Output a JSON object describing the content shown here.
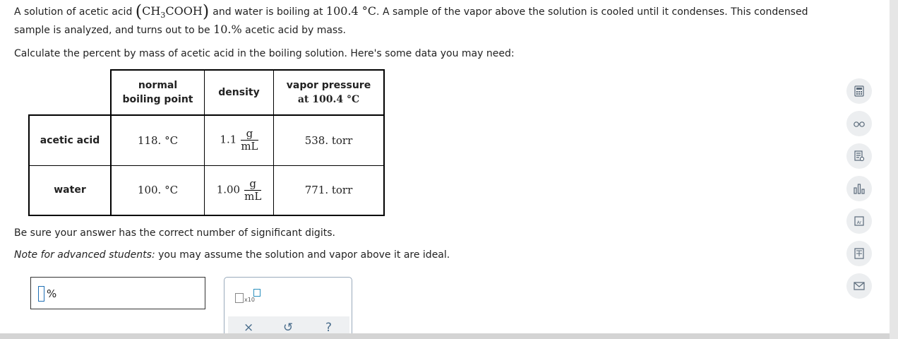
{
  "question": {
    "p1_a": "A solution of acetic acid",
    "formula": {
      "a": "CH",
      "sub": "3",
      "b": "COOH"
    },
    "p1_b": "and water is boiling at",
    "temp": "100.4 °C",
    "p1_c": ". A sample of the vapor above the solution is cooled until it condenses. This condensed",
    "p2_a": "sample is analyzed, and turns out to be",
    "pct": "10.%",
    "p2_b": "acetic acid by mass.",
    "p3": "Calculate the percent by mass of acetic acid in the boiling solution. Here's some data you may need:",
    "sigfigs": "Be sure your answer has the correct number of significant digits.",
    "note_label": "Note for advanced students:",
    "note_text": "you may assume the solution and vapor above it are ideal."
  },
  "table": {
    "headers": {
      "bp_1": "normal",
      "bp_2": "boiling point",
      "density": "density",
      "vp_1": "vapor pressure",
      "vp_2": "at 100.4 °C"
    },
    "rows": [
      {
        "label": "acetic acid",
        "bp": "118. °C",
        "density": "1.1",
        "unit_num": "g",
        "unit_den": "mL",
        "vp": "538. torr"
      },
      {
        "label": "water",
        "bp": "100. °C",
        "density": "1.00",
        "unit_num": "g",
        "unit_den": "mL",
        "vp": "771. torr"
      }
    ]
  },
  "answer": {
    "unit": "%",
    "x10_label": "x10"
  },
  "toolbar": {
    "clear": "×",
    "undo": "↺",
    "help": "?"
  },
  "side_tools": [
    "calculator-icon",
    "glasses-icon",
    "notes-icon",
    "chart-icon",
    "periodic-table-icon",
    "data-book-icon",
    "mail-icon"
  ]
}
